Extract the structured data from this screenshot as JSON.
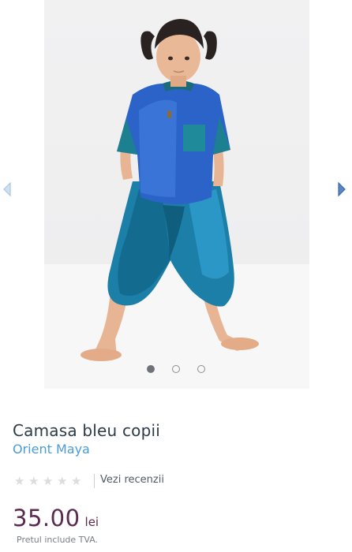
{
  "gallery": {
    "image_alt": "child in blue shirt and harem pants",
    "prev_icon": "chevron-left-icon",
    "next_icon": "chevron-right-icon",
    "slide_count": 3,
    "active_slide": 1,
    "colors": {
      "arrow": "#a9c7e3",
      "dot_active": "#6f7279"
    }
  },
  "product": {
    "title": "Camasa bleu copii",
    "brand": "Orient Maya"
  },
  "rating": {
    "stars": 0,
    "max_stars": 5,
    "star_icon": "star-icon",
    "reviews_link": "Vezi recenzii"
  },
  "price": {
    "amount": "35.00",
    "currency": "lei",
    "vat_note": "Pretul include TVA."
  },
  "colors": {
    "title": "#2b3b48",
    "brand": "#4a9cd6",
    "price": "#5c2a4c"
  }
}
